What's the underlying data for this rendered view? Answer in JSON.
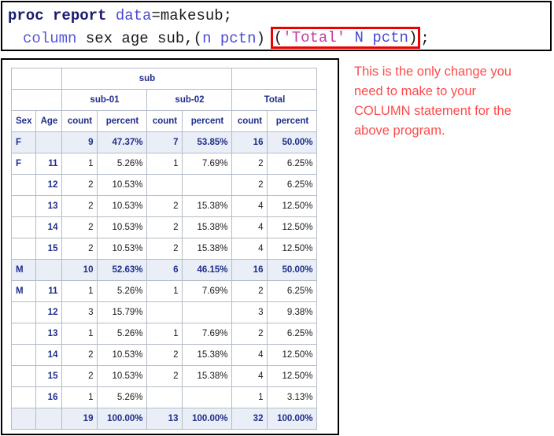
{
  "code": {
    "line1": {
      "keyword": "proc report",
      "space": " ",
      "option": "data",
      "rest": "=makesub;"
    },
    "line2": {
      "statement": "column",
      "mid": " sex age sub,(",
      "n": "n",
      "space1": " ",
      "pctn": "pctn",
      "close": ")",
      "highlight": {
        "open_paren": "(",
        "quoted": "'Total'",
        "space1": " ",
        "n_upper": "N",
        "space2": " ",
        "pctn": "pctn",
        "close_paren": ")"
      },
      "semicolon": ";"
    },
    "highlight_border_color": "#ee0000"
  },
  "annotation": {
    "color": "#fd4b4b",
    "line1": "This is the only change you",
    "line2": "need to make to your",
    "line3": "COLUMN statement for the",
    "line4": "above program."
  },
  "table": {
    "header_group": "sub",
    "groups": [
      "sub-01",
      "sub-02",
      "Total"
    ],
    "columns": [
      "Sex",
      "Age",
      "count",
      "percent",
      "count",
      "percent",
      "count",
      "percent"
    ],
    "rows": [
      {
        "type": "summary",
        "sex": "F",
        "age": "",
        "cells": [
          "9",
          "47.37%",
          "7",
          "53.85%",
          "16",
          "50.00%"
        ]
      },
      {
        "type": "data",
        "sex": "F",
        "age": "11",
        "cells": [
          "1",
          "5.26%",
          "1",
          "7.69%",
          "2",
          "6.25%"
        ]
      },
      {
        "type": "data",
        "sex": "",
        "age": "12",
        "cells": [
          "2",
          "10.53%",
          "",
          "",
          "2",
          "6.25%"
        ]
      },
      {
        "type": "data",
        "sex": "",
        "age": "13",
        "cells": [
          "2",
          "10.53%",
          "2",
          "15.38%",
          "4",
          "12.50%"
        ]
      },
      {
        "type": "data",
        "sex": "",
        "age": "14",
        "cells": [
          "2",
          "10.53%",
          "2",
          "15.38%",
          "4",
          "12.50%"
        ]
      },
      {
        "type": "data",
        "sex": "",
        "age": "15",
        "cells": [
          "2",
          "10.53%",
          "2",
          "15.38%",
          "4",
          "12.50%"
        ]
      },
      {
        "type": "summary",
        "sex": "M",
        "age": "",
        "cells": [
          "10",
          "52.63%",
          "6",
          "46.15%",
          "16",
          "50.00%"
        ]
      },
      {
        "type": "data",
        "sex": "M",
        "age": "11",
        "cells": [
          "1",
          "5.26%",
          "1",
          "7.69%",
          "2",
          "6.25%"
        ]
      },
      {
        "type": "data",
        "sex": "",
        "age": "12",
        "cells": [
          "3",
          "15.79%",
          "",
          "",
          "3",
          "9.38%"
        ]
      },
      {
        "type": "data",
        "sex": "",
        "age": "13",
        "cells": [
          "1",
          "5.26%",
          "1",
          "7.69%",
          "2",
          "6.25%"
        ]
      },
      {
        "type": "data",
        "sex": "",
        "age": "14",
        "cells": [
          "2",
          "10.53%",
          "2",
          "15.38%",
          "4",
          "12.50%"
        ]
      },
      {
        "type": "data",
        "sex": "",
        "age": "15",
        "cells": [
          "2",
          "10.53%",
          "2",
          "15.38%",
          "4",
          "12.50%"
        ]
      },
      {
        "type": "data",
        "sex": "",
        "age": "16",
        "cells": [
          "1",
          "5.26%",
          "",
          "",
          "1",
          "3.13%"
        ]
      },
      {
        "type": "summary",
        "sex": "",
        "age": "",
        "cells": [
          "19",
          "100.00%",
          "13",
          "100.00%",
          "32",
          "100.00%"
        ]
      }
    ]
  }
}
